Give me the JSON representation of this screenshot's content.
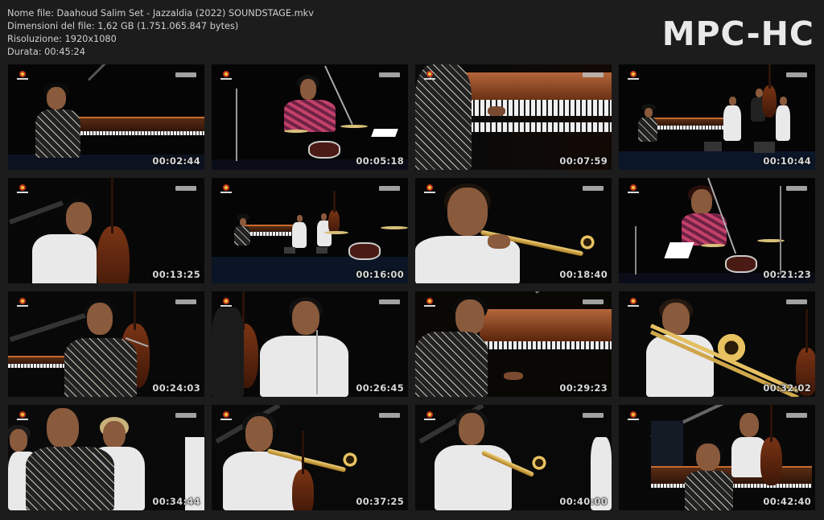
{
  "header": {
    "file_name": "Nome file: Daahoud Salim Set - Jazzaldia (2022) SOUNDSTAGE.mkv",
    "file_size": "Dimensioni del file: 1,62 GB (1.751.065.847 bytes)",
    "resolution": "Risoluzione: 1920x1080",
    "duration": "Durata: 00:45:24"
  },
  "brand": "MPC-HC",
  "thumbnails": [
    {
      "time": "00:02:44",
      "scene": "pianist-curly"
    },
    {
      "time": "00:05:18",
      "scene": "drummer"
    },
    {
      "time": "00:07:59",
      "scene": "piano-hands"
    },
    {
      "time": "00:10:44",
      "scene": "stage-wide"
    },
    {
      "time": "00:13:25",
      "scene": "bassist"
    },
    {
      "time": "00:16:00",
      "scene": "stage-far"
    },
    {
      "time": "00:18:40",
      "scene": "trumpet-close"
    },
    {
      "time": "00:21:23",
      "scene": "drummer-2"
    },
    {
      "time": "00:24:03",
      "scene": "singer"
    },
    {
      "time": "00:26:45",
      "scene": "man-mic"
    },
    {
      "time": "00:29:23",
      "scene": "piano-player-2"
    },
    {
      "time": "00:32:02",
      "scene": "trombone"
    },
    {
      "time": "00:34:44",
      "scene": "group-singer"
    },
    {
      "time": "00:37:25",
      "scene": "trumpet-2"
    },
    {
      "time": "00:40:00",
      "scene": "trumpet-3"
    },
    {
      "time": "00:42:40",
      "scene": "piano-bass"
    }
  ]
}
